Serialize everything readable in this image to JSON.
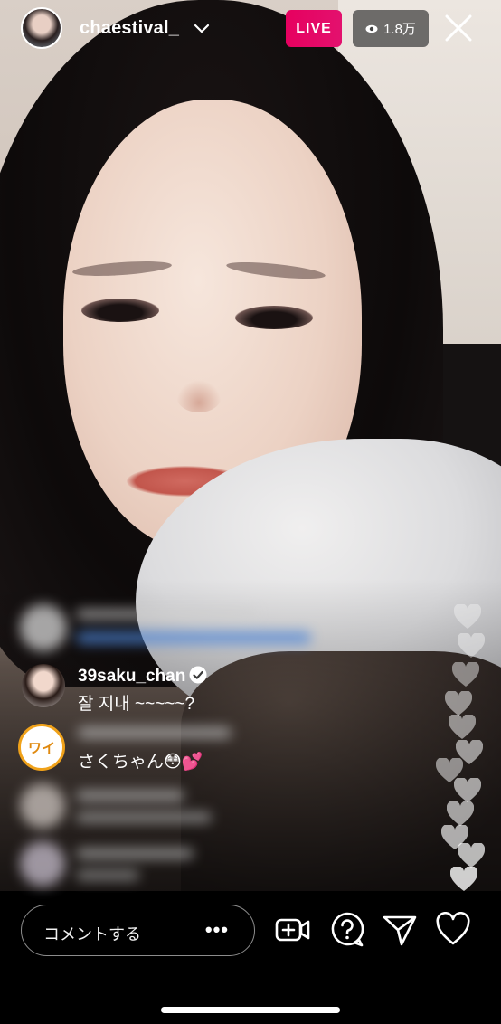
{
  "header": {
    "username": "chaestival_",
    "live_label": "LIVE",
    "viewer_count": "1.8万",
    "colors": {
      "live_badge": "#E3116E"
    }
  },
  "comments": [
    {
      "username": "39saku_chan",
      "verified": true,
      "text": "잘 지내 ~~~~~?"
    },
    {
      "badge_text": "ワイ",
      "text": "さくちゃん😳💕"
    }
  ],
  "composer": {
    "placeholder": "コメントする",
    "more_label": "•••"
  },
  "actions": [
    "add-video-icon",
    "question-icon",
    "send-icon",
    "heart-icon"
  ]
}
